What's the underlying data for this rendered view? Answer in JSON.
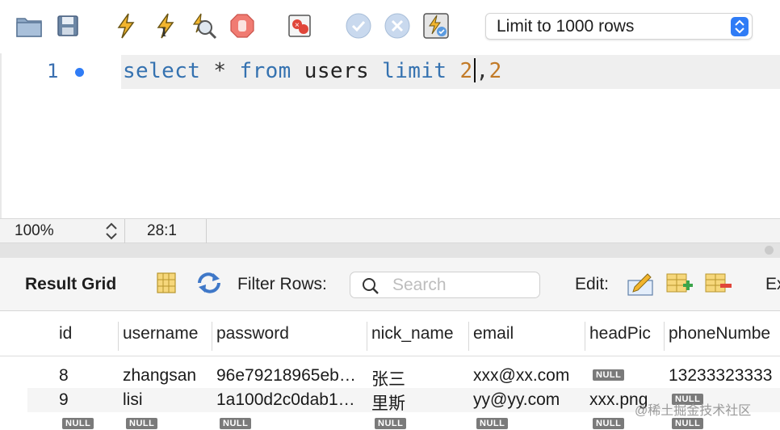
{
  "toolbar": {
    "icons": [
      "open-folder-icon",
      "save-icon",
      "execute-icon",
      "execute-current-icon",
      "explain-icon",
      "stop-icon",
      "error-toggle-icon",
      "commit-icon",
      "rollback-icon",
      "autocommit-icon"
    ],
    "limit_select": "Limit to 1000 rows"
  },
  "editor": {
    "line_number": "1",
    "tokens": {
      "select": "select",
      "star": "*",
      "from": "from",
      "table": "users",
      "limit": "limit",
      "offset": "2",
      "comma": ",",
      "count": "2"
    }
  },
  "status": {
    "zoom": "100%",
    "cursor": "28:1"
  },
  "results": {
    "title": "Result Grid",
    "filter_label": "Filter Rows:",
    "search_placeholder": "Search",
    "edit_label": "Edit:",
    "export_label": "Ex"
  },
  "grid": {
    "columns": [
      "id",
      "username",
      "password",
      "nick_name",
      "email",
      "headPic",
      "phoneNumbe"
    ],
    "null_label": "NULL",
    "rows": [
      {
        "id": "8",
        "username": "zhangsan",
        "password": "96e79218965eb…",
        "nick_name": "张三",
        "email": "xxx@xx.com",
        "headPic": null,
        "phoneNumber": "13233323333"
      },
      {
        "id": "9",
        "username": "lisi",
        "password": "1a100d2c0dab1…",
        "nick_name": "里斯",
        "email": "yy@yy.com",
        "headPic": "xxx.png",
        "phoneNumber": null
      },
      {
        "id": null,
        "username": null,
        "password": null,
        "nick_name": null,
        "email": null,
        "headPic": null,
        "phoneNumber": null
      }
    ]
  },
  "watermark": "@稀土掘金技术社区",
  "colors": {
    "keyword": "#3572b0",
    "number": "#c27a27",
    "accent": "#2f7cf6",
    "null_badge": "#7a7a7a"
  }
}
